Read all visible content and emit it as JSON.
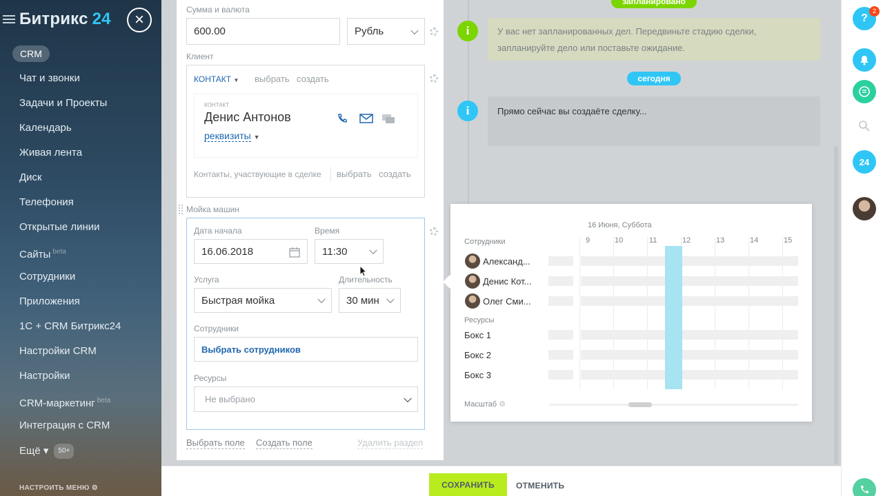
{
  "sidebar": {
    "logo_main": "Битрикс",
    "logo_num": "24",
    "active_section": "CRM",
    "items": [
      {
        "label": "Чат и звонки",
        "tag": ""
      },
      {
        "label": "Задачи и Проекты",
        "tag": ""
      },
      {
        "label": "Календарь",
        "tag": ""
      },
      {
        "label": "Живая лента",
        "tag": ""
      },
      {
        "label": "Диск",
        "tag": ""
      },
      {
        "label": "Телефония",
        "tag": ""
      },
      {
        "label": "Открытые линии",
        "tag": ""
      },
      {
        "label": "Сайты",
        "tag": "beta"
      },
      {
        "label": "Сотрудники",
        "tag": ""
      },
      {
        "label": "Приложения",
        "tag": ""
      },
      {
        "label": "1С + CRM Битрикс24",
        "tag": ""
      },
      {
        "label": "Настройки CRM",
        "tag": ""
      },
      {
        "label": "Настройки",
        "tag": ""
      },
      {
        "label": "CRM-маркетинг",
        "tag": "beta"
      },
      {
        "label": "Интеграция с CRM",
        "tag": ""
      }
    ],
    "more": {
      "label": "Ещё",
      "count": "50+"
    },
    "customize": "НАСТРОИТЬ МЕНЮ"
  },
  "form": {
    "amount_label": "Сумма и валюта",
    "amount_value": "600.00",
    "currency_value": "Рубль",
    "client_label": "Клиент",
    "contact_tab": "КОНТАКТ",
    "select": "выбрать",
    "create": "создать",
    "contact_card_label": "КОНТАКТ",
    "contact_name": "Денис Антонов",
    "requisites": "реквизиты",
    "contacts_in_deal": "Контакты, участвующие в сделке",
    "section_title": "Мойка машин",
    "start_date_label": "Дата начала",
    "start_date_value": "16.06.2018",
    "time_label": "Время",
    "time_value": "11:30",
    "service_label": "Услуга",
    "service_value": "Быстрая мойка",
    "duration_label": "Длительность",
    "duration_value": "30 мин",
    "employees_label": "Сотрудники",
    "employees_select": "Выбрать сотрудников",
    "resources_label": "Ресурсы",
    "resources_value": "Не выбрано",
    "select_field": "Выбрать поле",
    "create_field": "Создать поле",
    "delete_section": "Удалить раздел"
  },
  "timeline": {
    "planned_pill": "запланировано",
    "no_plans_text": "У вас нет запланированных дел. Передвиньте стадию сделки, запланируйте дело или поставьте ожидание.",
    "today_pill": "сегодня",
    "creating_text": "Прямо сейчас вы создаёте сделку..."
  },
  "calendar": {
    "date_title": "16 Июня, Суббота",
    "hours": [
      "9",
      "10",
      "11",
      "12",
      "13",
      "14",
      "15"
    ],
    "employees_label": "Сотрудники",
    "employees": [
      "Александ...",
      "Денис Кот...",
      "Олег Сми..."
    ],
    "resources_label": "Ресурсы",
    "resources": [
      "Бокс 1",
      "Бокс 2",
      "Бокс 3"
    ],
    "scale_label": "Масштаб"
  },
  "footer": {
    "save": "СОХРАНИТЬ",
    "cancel": "ОТМЕНИТЬ"
  },
  "rightbar": {
    "help_badge": "2",
    "b24_label": "24"
  },
  "colors": {
    "accent": "#2fc6f6",
    "save": "#b9ec1f",
    "green_info": "#7bd500",
    "link": "#2067b0"
  }
}
